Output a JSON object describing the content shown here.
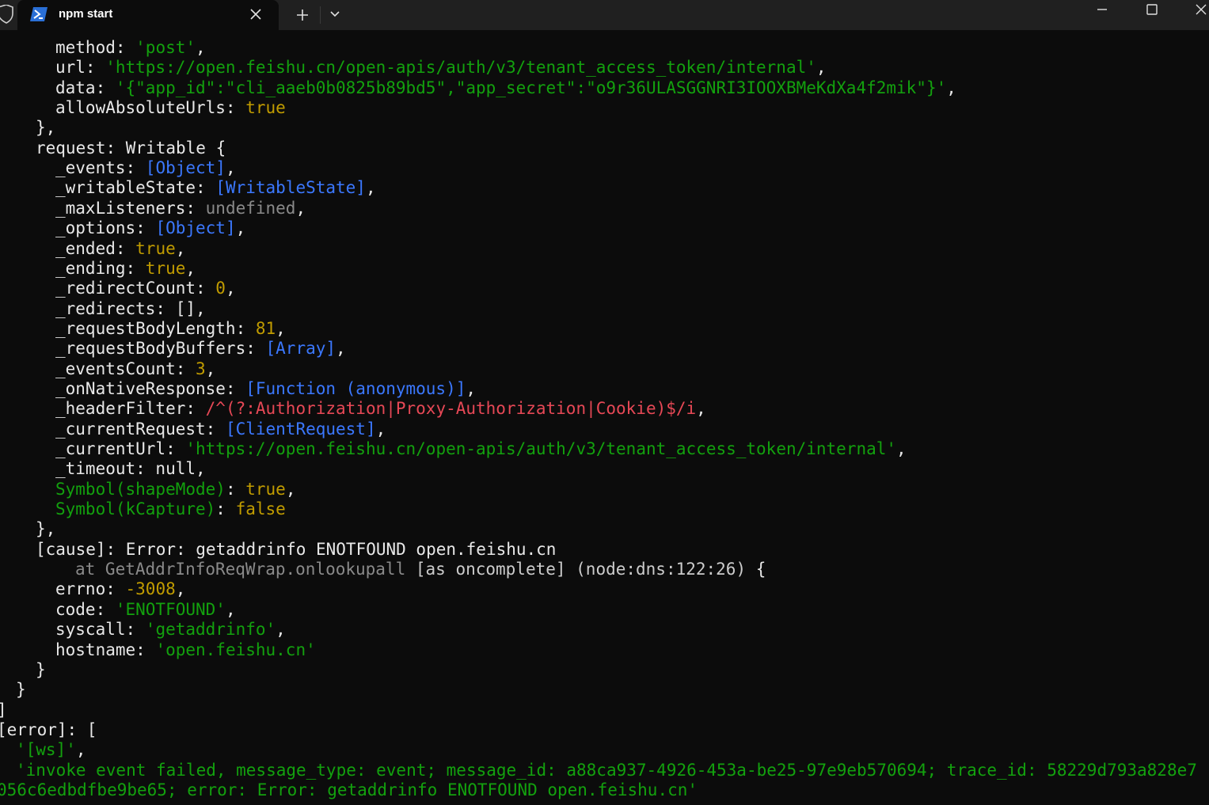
{
  "window": {
    "tab_title": "npm start",
    "icons": {
      "shield": "shield-icon",
      "terminal": "powershell-icon",
      "tab_close": "close-icon",
      "new_tab": "plus-icon",
      "dropdown": "chevron-down-icon",
      "minimize": "minimize-icon",
      "maximize": "maximize-icon",
      "close": "close-icon"
    }
  },
  "colors": {
    "string": "#13a10e",
    "number": "#c19c00",
    "special": "#3b78ff",
    "regexp": "#e74856",
    "undefined": "#8a8a8a"
  },
  "lines": [
    {
      "indent": 3,
      "segs": [
        {
          "t": "method: "
        },
        {
          "t": "'post'",
          "c": "g"
        },
        {
          "t": ","
        }
      ]
    },
    {
      "indent": 3,
      "segs": [
        {
          "t": "url: "
        },
        {
          "t": "'https://open.feishu.cn/open-apis/auth/v3/tenant_access_token/internal'",
          "c": "g"
        },
        {
          "t": ","
        }
      ]
    },
    {
      "indent": 3,
      "segs": [
        {
          "t": "data: "
        },
        {
          "t": "'{\"app_id\":\"cli_aaeb0b0825b89bd5\",\"app_secret\":\"o9r36ULASGGNRI3IOOXBMeKdXa4f2mik\"}'",
          "c": "g"
        },
        {
          "t": ","
        }
      ]
    },
    {
      "indent": 3,
      "segs": [
        {
          "t": "allowAbsoluteUrls: "
        },
        {
          "t": "true",
          "c": "y"
        }
      ]
    },
    {
      "indent": 2,
      "segs": [
        {
          "t": "},"
        }
      ]
    },
    {
      "indent": 2,
      "segs": [
        {
          "t": "request: Writable {"
        }
      ]
    },
    {
      "indent": 3,
      "segs": [
        {
          "t": "_events: "
        },
        {
          "t": "[Object]",
          "c": "b"
        },
        {
          "t": ","
        }
      ]
    },
    {
      "indent": 3,
      "segs": [
        {
          "t": "_writableState: "
        },
        {
          "t": "[WritableState]",
          "c": "b"
        },
        {
          "t": ","
        }
      ]
    },
    {
      "indent": 3,
      "segs": [
        {
          "t": "_maxListeners: "
        },
        {
          "t": "undefined",
          "c": "d"
        },
        {
          "t": ","
        }
      ]
    },
    {
      "indent": 3,
      "segs": [
        {
          "t": "_options: "
        },
        {
          "t": "[Object]",
          "c": "b"
        },
        {
          "t": ","
        }
      ]
    },
    {
      "indent": 3,
      "segs": [
        {
          "t": "_ended: "
        },
        {
          "t": "true",
          "c": "y"
        },
        {
          "t": ","
        }
      ]
    },
    {
      "indent": 3,
      "segs": [
        {
          "t": "_ending: "
        },
        {
          "t": "true",
          "c": "y"
        },
        {
          "t": ","
        }
      ]
    },
    {
      "indent": 3,
      "segs": [
        {
          "t": "_redirectCount: "
        },
        {
          "t": "0",
          "c": "y"
        },
        {
          "t": ","
        }
      ]
    },
    {
      "indent": 3,
      "segs": [
        {
          "t": "_redirects: [],"
        }
      ]
    },
    {
      "indent": 3,
      "segs": [
        {
          "t": "_requestBodyLength: "
        },
        {
          "t": "81",
          "c": "y"
        },
        {
          "t": ","
        }
      ]
    },
    {
      "indent": 3,
      "segs": [
        {
          "t": "_requestBodyBuffers: "
        },
        {
          "t": "[Array]",
          "c": "b"
        },
        {
          "t": ","
        }
      ]
    },
    {
      "indent": 3,
      "segs": [
        {
          "t": "_eventsCount: "
        },
        {
          "t": "3",
          "c": "y"
        },
        {
          "t": ","
        }
      ]
    },
    {
      "indent": 3,
      "segs": [
        {
          "t": "_onNativeResponse: "
        },
        {
          "t": "[Function (anonymous)]",
          "c": "b"
        },
        {
          "t": ","
        }
      ]
    },
    {
      "indent": 3,
      "segs": [
        {
          "t": "_headerFilter: "
        },
        {
          "t": "/^(?:Authorization|Proxy-Authorization|Cookie)$/i",
          "c": "r"
        },
        {
          "t": ","
        }
      ]
    },
    {
      "indent": 3,
      "segs": [
        {
          "t": "_currentRequest: "
        },
        {
          "t": "[ClientRequest]",
          "c": "b"
        },
        {
          "t": ","
        }
      ]
    },
    {
      "indent": 3,
      "segs": [
        {
          "t": "_currentUrl: "
        },
        {
          "t": "'https://open.feishu.cn/open-apis/auth/v3/tenant_access_token/internal'",
          "c": "g"
        },
        {
          "t": ","
        }
      ]
    },
    {
      "indent": 3,
      "segs": [
        {
          "t": "_timeout: null,"
        }
      ]
    },
    {
      "indent": 3,
      "segs": [
        {
          "t": "Symbol(shapeMode)",
          "c": "g"
        },
        {
          "t": ": "
        },
        {
          "t": "true",
          "c": "y"
        },
        {
          "t": ","
        }
      ]
    },
    {
      "indent": 3,
      "segs": [
        {
          "t": "Symbol(kCapture)",
          "c": "g"
        },
        {
          "t": ": "
        },
        {
          "t": "false",
          "c": "y"
        }
      ]
    },
    {
      "indent": 2,
      "segs": [
        {
          "t": "},"
        }
      ]
    },
    {
      "indent": 2,
      "segs": [
        {
          "t": "[cause]: Error: getaddrinfo ENOTFOUND open.feishu.cn"
        }
      ]
    },
    {
      "indent": 4,
      "segs": [
        {
          "t": "at GetAddrInfoReqWrap.onlookupall ",
          "c": "d"
        },
        {
          "t": "[as oncomplete] (node:dns:122:26)",
          "c": "gr"
        },
        {
          "t": " {"
        }
      ]
    },
    {
      "indent": 3,
      "segs": [
        {
          "t": "errno: "
        },
        {
          "t": "-3008",
          "c": "y"
        },
        {
          "t": ","
        }
      ]
    },
    {
      "indent": 3,
      "segs": [
        {
          "t": "code: "
        },
        {
          "t": "'ENOTFOUND'",
          "c": "g"
        },
        {
          "t": ","
        }
      ]
    },
    {
      "indent": 3,
      "segs": [
        {
          "t": "syscall: "
        },
        {
          "t": "'getaddrinfo'",
          "c": "g"
        },
        {
          "t": ","
        }
      ]
    },
    {
      "indent": 3,
      "segs": [
        {
          "t": "hostname: "
        },
        {
          "t": "'open.feishu.cn'",
          "c": "g"
        }
      ]
    },
    {
      "indent": 2,
      "segs": [
        {
          "t": "}"
        }
      ]
    },
    {
      "indent": 1,
      "segs": [
        {
          "t": "}"
        }
      ]
    },
    {
      "indent": 0,
      "segs": [
        {
          "t": "]"
        }
      ]
    },
    {
      "indent": 0,
      "segs": [
        {
          "t": "[error]: ["
        }
      ]
    },
    {
      "indent": 1,
      "segs": [
        {
          "t": "'[ws]'",
          "c": "g"
        },
        {
          "t": ","
        }
      ]
    },
    {
      "indent": 1,
      "segs": [
        {
          "t": "'invoke event failed, message_type: event; message_id: a88ca937-4926-453a-be25-97e9eb570694; trace_id: 58229d793a828e7",
          "c": "g"
        }
      ]
    },
    {
      "indent": 0,
      "segs": [
        {
          "t": "056c6edbdfbe9be65; error: Error: getaddrinfo ENOTFOUND open.feishu.cn'",
          "c": "g"
        }
      ]
    }
  ]
}
